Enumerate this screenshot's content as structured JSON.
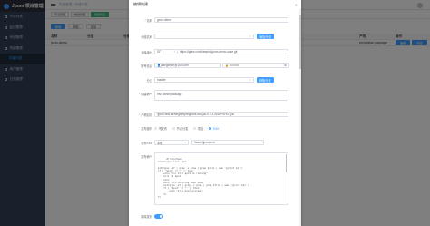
{
  "app": {
    "title": "Jpom 项目管理"
  },
  "sidebar": {
    "items": [
      {
        "label": "节点列表"
      },
      {
        "label": "监控管理"
      },
      {
        "label": "系统管理"
      },
      {
        "label": "构建管理"
      },
      {
        "label": "构建列表",
        "sub": true,
        "active": true
      },
      {
        "label": "用户管理"
      },
      {
        "label": "日志管理"
      }
    ]
  },
  "topbar": {
    "breadcrumb": "构建管理 / 构建列表"
  },
  "tags": [
    "节点管理",
    "构建管理",
    "构建列表"
  ],
  "toolbar": {
    "add": "新增",
    "refresh": "刷新",
    "batch": "批量"
  },
  "table": {
    "headers": [
      "名称",
      "分组",
      "仓库",
      "产物",
      "操作"
    ],
    "rows": [
      {
        "name": "jpom-demo",
        "group": "",
        "repo": "",
        "artifact": "mvn clean package",
        "action_edit": "编辑",
        "action_build": "构建"
      }
    ]
  },
  "dialog": {
    "title": "编辑构建",
    "close": "✕",
    "name_label": "名称",
    "name_value": "jpom-demo",
    "group_label": "分组名称",
    "group_placeholder": "",
    "group_button": "添加分组",
    "repo_label": "仓库地址",
    "repo_type": "GIT",
    "repo_url": "https://gitee.com/keepbx/jpom-demo-case.git",
    "account_label": "账号信息",
    "account_user": "jiangzeyin@163.com",
    "account_pwd": "••••••••••",
    "branch_label": "分支",
    "branch_value": "master",
    "branch_button": "获取分支",
    "build_cmd_label": "构建命令",
    "build_cmd_value": "mvn clean package",
    "artifact_label": "产物目录",
    "artifact_value": "/jpom-test-jar/target/springboot-test-jar-0.0.1-SNAPSHOT.jar",
    "release_label": "发布操作",
    "release_options": [
      "不发布",
      "节点分发",
      "项目",
      "SSH"
    ],
    "release_selected": 3,
    "ssh_label": "发布SSH",
    "ssh_select": "本地",
    "ssh_dir": "/home/jpom/test",
    "release_cmd_label": "发布命令",
    "release_cmd": "#!/bin/bash\nfile=\"jpom-test.jar\"\n\npid=$(ps -ef | grep -v grep | grep $file | awk '{print $2}')\nif [ \"$pid\" != \"\" ]; then\n    echo \">>> kill $pid is running\"\n    kill -9 $pid\n    echo\n    echo \">>> Shutting down mode\"\n    pid=$(ps -ef | grep -v grep | grep $file | awk '{print $2}')\n    if [ \"$pid\" != \"\" ]; then\n        echo \"kill boot process\"\n    fi\nfi",
    "clear_label": "清除发布",
    "clear_on": true
  },
  "colors": {
    "primary": "#409eff",
    "sidebar": "#304156",
    "active_tag": "#42b983"
  }
}
